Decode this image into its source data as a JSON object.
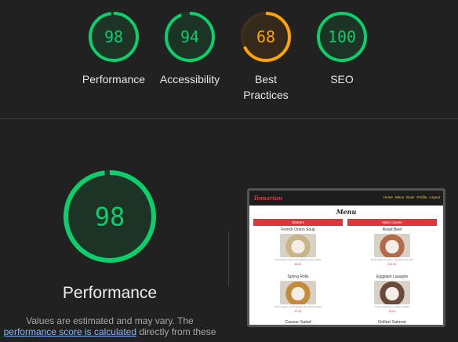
{
  "category_gauges": [
    {
      "score": "98",
      "fraction": 0.98,
      "label_lines": [
        "Performance"
      ],
      "color": "#0cce6b",
      "bg": "#1c3326",
      "ring_bg": "#1f3a2b"
    },
    {
      "score": "94",
      "fraction": 0.94,
      "label_lines": [
        "Accessibility"
      ],
      "color": "#0cce6b",
      "bg": "#1c3326",
      "ring_bg": "#1f3a2b"
    },
    {
      "score": "68",
      "fraction": 0.68,
      "label_lines": [
        "Best",
        "Practices"
      ],
      "color": "#ffa400",
      "bg": "#34291a",
      "ring_bg": "#3e301a"
    },
    {
      "score": "100",
      "fraction": 1.0,
      "label_lines": [
        "SEO"
      ],
      "color": "#0cce6b",
      "bg": "#1c3326",
      "ring_bg": "#1f3a2b"
    }
  ],
  "performance": {
    "score": "98",
    "fraction": 0.98,
    "title": "Performance",
    "desc_prefix": "Values are estimated and may vary. The",
    "desc_link": "performance score is calculated",
    "desc_suffix": " directly from these"
  },
  "screenshot": {
    "brand": "Tomarian",
    "nav_links": [
      "Home",
      "Menu",
      "Book",
      "Profile",
      "Logout"
    ],
    "menu_title": "Menu",
    "columns": [
      {
        "category": "Starters",
        "dishes": [
          {
            "name": "French Onion Soup",
            "desc": "caramelised onions and melted Gruyère cheese",
            "price": "£6.00",
            "img_color": "#c9b48a"
          },
          {
            "name": "Spring Rolls",
            "desc": "Fresh veggies, savory fillings, and delicate pastry",
            "price": "£7.00",
            "img_color": "#c58a3a"
          }
        ],
        "tail": "Caesar Salad"
      },
      {
        "category": "Main Course",
        "dishes": [
          {
            "name": "Roast Beef",
            "desc": "Tender slices of tender, roast beef and sides",
            "price": "£15.00",
            "img_color": "#b56a4a"
          },
          {
            "name": "Eggplant Lasagne",
            "desc": "Tender apple and of sautéed details",
            "price": "£9.00",
            "img_color": "#6a4a3a"
          }
        ],
        "tail": "Grilled Salmon"
      }
    ]
  }
}
